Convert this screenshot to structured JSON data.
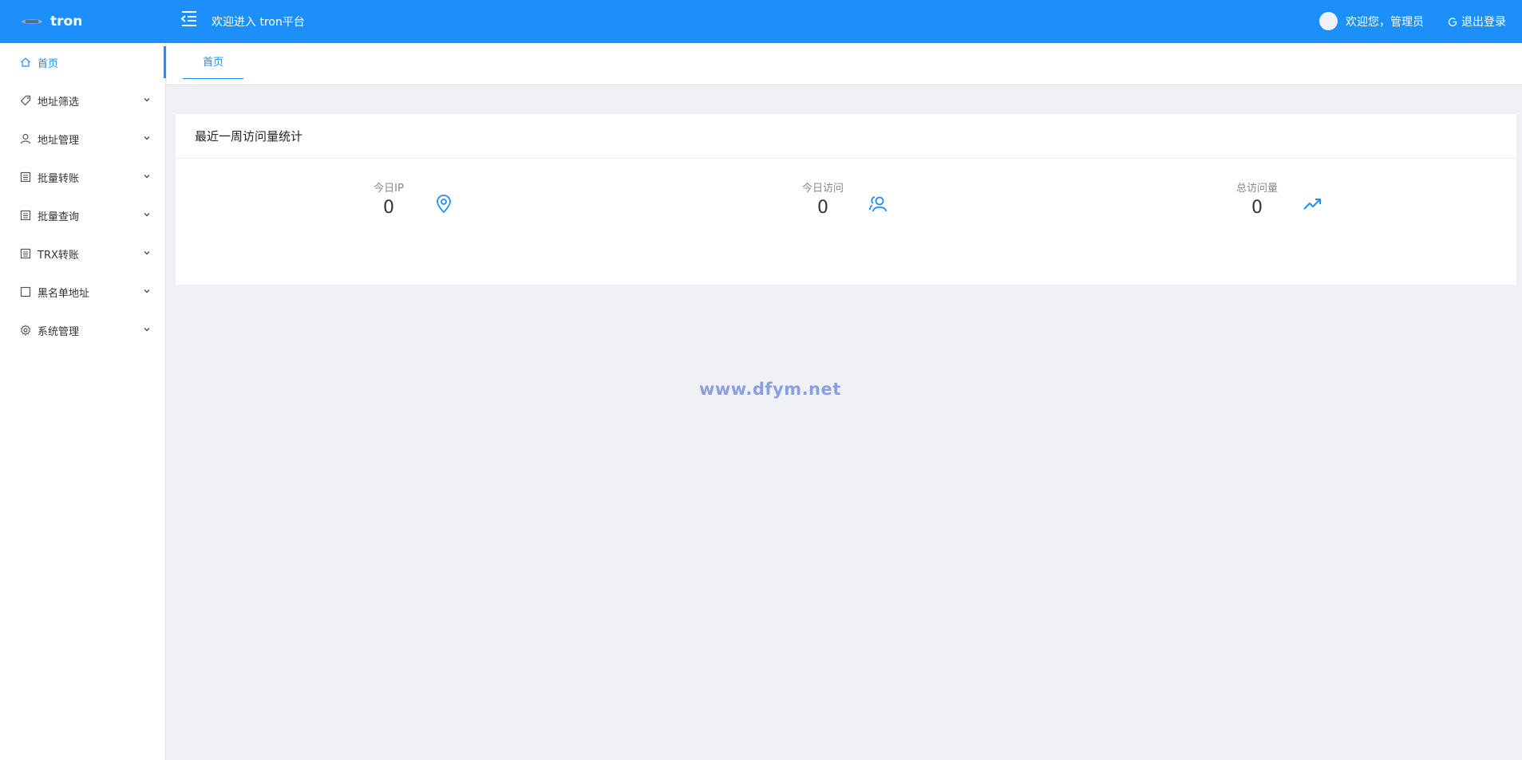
{
  "header": {
    "brand": "tron",
    "welcome": "欢迎进入 tron平台",
    "user_greeting": "欢迎您，管理员",
    "logout_label": "退出登录"
  },
  "sidebar": {
    "items": [
      {
        "label": "首页",
        "icon": "home-icon"
      },
      {
        "label": "地址筛选",
        "icon": "tag-icon"
      },
      {
        "label": "地址管理",
        "icon": "user-icon"
      },
      {
        "label": "批量转账",
        "icon": "list-icon"
      },
      {
        "label": "批量查询",
        "icon": "list-icon"
      },
      {
        "label": "TRX转账",
        "icon": "list-icon"
      },
      {
        "label": "黑名单地址",
        "icon": "square-icon"
      },
      {
        "label": "系统管理",
        "icon": "gear-icon"
      }
    ]
  },
  "tabs": [
    {
      "label": "首页"
    }
  ],
  "card": {
    "title": "最近一周访问量统计",
    "stats": [
      {
        "label": "今日IP",
        "value": "0",
        "icon": "location-icon"
      },
      {
        "label": "今日访问",
        "value": "0",
        "icon": "users-icon"
      },
      {
        "label": "总访问量",
        "value": "0",
        "icon": "trend-icon"
      }
    ]
  },
  "watermark": "www.dfym.net",
  "colors": {
    "accent": "#1c8ffa",
    "background": "#eff1f5"
  }
}
